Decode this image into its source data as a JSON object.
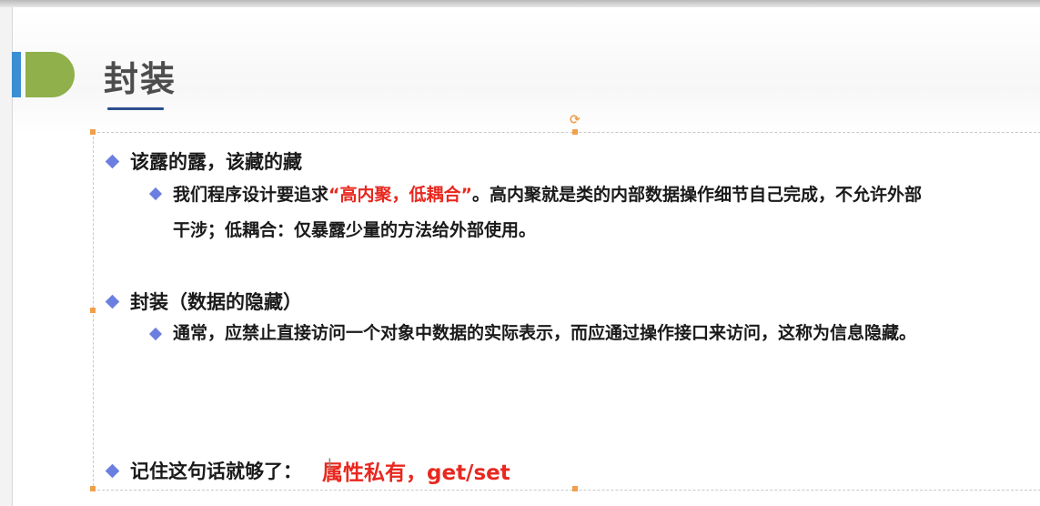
{
  "slide": {
    "title": "封装",
    "bullets": [
      {
        "heading": "该露的露，该藏的藏",
        "sub": {
          "prefix": "我们程序设计要追求",
          "highlight": "“高内聚，低耦合”",
          "suffix_line1": "。高内聚就是类的内部数据操作细节自己完成，不允许外部",
          "line2": "干涉；低耦合：仅暴露少量的方法给外部使用。"
        }
      },
      {
        "heading": "封装（数据的隐藏）",
        "sub": {
          "text": "通常，应禁止直接访问一个对象中数据的实际表示，而应通过操作接口来访问，这称为信息隐藏。"
        }
      },
      {
        "heading": "记住这句话就够了：",
        "highlight": "属性私有，get/set"
      }
    ]
  },
  "colors": {
    "bullet": "#6b7fe0",
    "highlight": "#e8281f",
    "title": "#4d4d4d",
    "accent_green": "#8fb04a",
    "accent_blue": "#3a8fd4",
    "selection_handle": "#f0a04b"
  },
  "icons": [
    "diamond-bullet-icon",
    "rotate-handle-icon",
    "text-cursor-icon"
  ]
}
